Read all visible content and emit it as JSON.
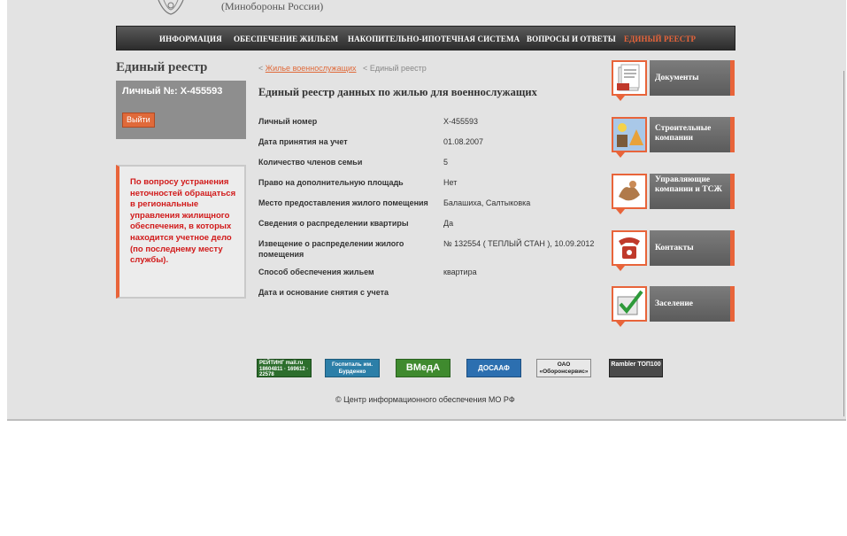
{
  "header": {
    "ministry": "(Минобороны России)"
  },
  "nav": {
    "items": [
      {
        "label": "ИНФОРМАЦИЯ"
      },
      {
        "label": "ОБЕСПЕЧЕНИЕ ЖИЛЬЕМ"
      },
      {
        "label": "НАКОПИТЕЛЬНО-ИПОТЕЧНАЯ СИСТЕМА"
      },
      {
        "label": "ВОПРОСЫ И ОТВЕТЫ"
      },
      {
        "label": "ЕДИНЫЙ РЕЕСТР"
      }
    ]
  },
  "left": {
    "title": "Единый реестр",
    "user_label": "Личный №: Х-455593",
    "logout": "Выйти",
    "notice": "По вопросу устранения неточностей обращаться в региональные управления жилищного обеспечения, в которых находится учетное дело (по последнему месту службы)."
  },
  "breadcrumb": {
    "sep1": "<",
    "link": "Жилье военнослужащих",
    "sep2": "<",
    "current": "Единый реестр"
  },
  "main": {
    "title": "Единый реестр данных по жилью для военнослужащих",
    "rows": [
      {
        "label": "Личный номер",
        "value": "Х-455593"
      },
      {
        "label": "Дата принятия на учет",
        "value": "01.08.2007"
      },
      {
        "label": "Количество членов семьи",
        "value": "5"
      },
      {
        "label": "Право на дополнительную площадь",
        "value": "Нет"
      },
      {
        "label": "Место предоставления жилого помещения",
        "value": "Балашиха, Салтыковка"
      },
      {
        "label": "Сведения о распределении квартиры",
        "value": "Да"
      },
      {
        "label": "Извещение о распределении жилого помещения",
        "value": "№ 132554 ( ТЕПЛЫЙ СТАН ), 10.09.2012"
      },
      {
        "label": "Способ обеспечения жильем",
        "value": "квартира"
      },
      {
        "label": "Дата и основание снятия с учета",
        "value": ""
      }
    ]
  },
  "side": {
    "items": [
      {
        "label": "Документы",
        "icon": "documents-icon"
      },
      {
        "label": "Строительные компании",
        "icon": "construction-icon"
      },
      {
        "label": "Управляющие компании и ТСЖ",
        "icon": "handshake-icon"
      },
      {
        "label": "Контакты",
        "icon": "phone-icon"
      },
      {
        "label": "Заселение",
        "icon": "checkmark-icon"
      }
    ]
  },
  "banners": {
    "rating": "РЕЙТИНГ mail.ru",
    "rating_nums": "18604811 · 169612 · 22578",
    "hospital": "Госпиталь им. Бурденко",
    "vmeda": "ВМедА",
    "dosaaf": "ДОСААФ",
    "oao": "ОАО «Оборонсервис»",
    "rambler": "Rambler ТОП100"
  },
  "footer": {
    "copyright": "© Центр информационного обеспечения МО РФ"
  },
  "colors": {
    "accent": "#e8643a",
    "nav_bg": "#3a3a3a",
    "notice_text": "#d11a1a",
    "panel_gray": "#8e8e8e"
  }
}
